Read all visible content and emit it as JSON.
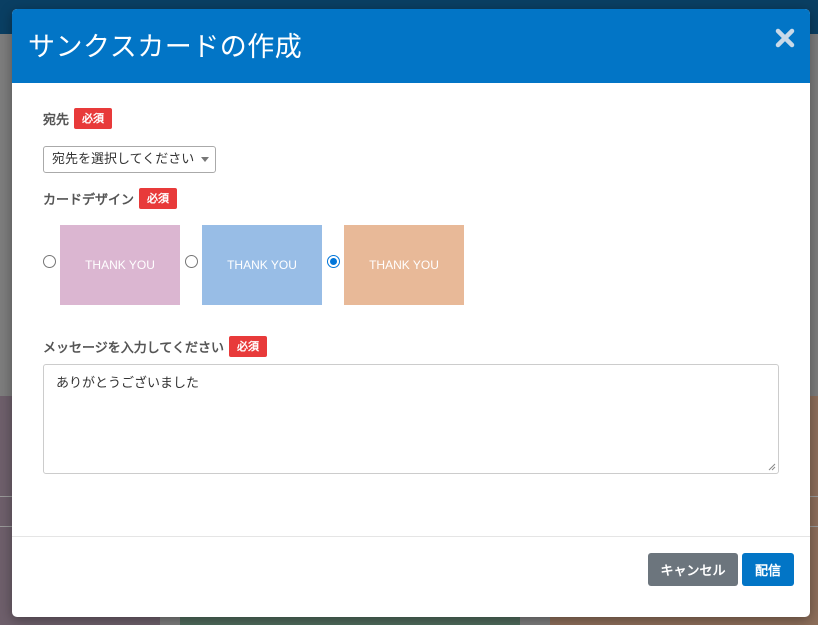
{
  "modal": {
    "title": "サンクスカードの作成",
    "close_icon": "close-icon"
  },
  "recipient": {
    "label": "宛先",
    "required_badge": "必須",
    "select_value": "宛先を選択してください"
  },
  "design": {
    "label": "カードデザイン",
    "required_badge": "必須",
    "options": [
      {
        "text": "THANK YOU",
        "color": "#dbb6d1",
        "selected": false
      },
      {
        "text": "THANK YOU",
        "color": "#98bde6",
        "selected": false
      },
      {
        "text": "THANK YOU",
        "color": "#e8b998",
        "selected": true
      }
    ]
  },
  "message": {
    "label": "メッセージを入力してください",
    "required_badge": "必須",
    "value": "ありがとうございました"
  },
  "footer": {
    "cancel_label": "キャンセル",
    "send_label": "配信"
  },
  "colors": {
    "accent": "#0275c6",
    "required": "#e83a3a",
    "cancel": "#6c757d"
  }
}
